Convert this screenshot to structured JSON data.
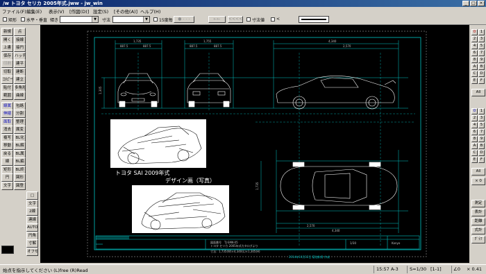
{
  "window": {
    "title": "/w トヨタ セリカ 2005年式.jww - jw_win",
    "min": "_",
    "max": "□",
    "close": "×"
  },
  "menu": [
    "ファイル(F)",
    "編集(E)",
    "表示(V)",
    "[作図(D)]",
    "設定(S)",
    "[その他(A)]",
    "ヘルプ(H)"
  ],
  "toolbar": {
    "rect": "矩形",
    "hv": "水平・垂直",
    "angle": "傾き",
    "dim": "寸法",
    "deg15": "15度毎",
    "dim_value": "寸法値",
    "arrow1": "<",
    "btn_left": "←←",
    "btn_mid": "<<<<"
  },
  "left_panel": {
    "buttons": [
      [
        "新規",
        "点"
      ],
      [
        "開く",
        "接線"
      ],
      [
        "上書",
        "接円"
      ],
      [
        "保存",
        "ハッチ"
      ],
      [
        "印刷",
        "建平"
      ],
      [
        "切取",
        "建断"
      ],
      [
        "コピー",
        "建立"
      ],
      [
        "貼付",
        "多角形"
      ],
      [
        "範囲",
        "曲線"
      ],
      [
        "線属",
        "包絡"
      ],
      [
        "伸縮",
        "分割"
      ],
      [
        "面取",
        "整理"
      ],
      [
        "消去",
        "属変"
      ],
      [
        "複写",
        "BL化"
      ],
      [
        "移動",
        "BL解"
      ],
      [
        "戻る",
        "BL属"
      ],
      [
        "線",
        "BL編"
      ],
      [
        "矩形",
        "BL終"
      ],
      [
        "円",
        "図形"
      ],
      [
        "文字",
        "図登"
      ]
    ],
    "mid_buttons": [
      [
        "/",
        "□"
      ],
      [
        "○",
        "文字"
      ],
      [
        "寸法",
        "2線"
      ],
      [
        "中心線",
        "連線"
      ],
      [
        "AUTO",
        ""
      ],
      [
        "線角",
        "円角"
      ],
      [
        "寸化",
        "寸解"
      ],
      [
        "ソリッド",
        "オフセット"
      ],
      [
        "寸取",
        "2.5D"
      ],
      [
        "日影",
        "天空"
      ],
      [
        "SPEED",
        "測定"
      ]
    ],
    "auto": "AUTO"
  },
  "right_panel": {
    "layer_digits": [
      "0",
      "1",
      "2",
      "3",
      "4",
      "5",
      "6",
      "7",
      "8",
      "9",
      "A",
      "B",
      "C",
      "D",
      "E",
      "F"
    ],
    "all": "All",
    "ex": "× 0",
    "bottom": [
      "測定",
      "表計",
      "距離",
      "式計",
      "ｸﾞﾗﾌ"
    ]
  },
  "drawing": {
    "caption1": "トヨタ SAI 2009年式",
    "caption2": "デザイン画（写真）",
    "dims_top": [
      "1,735",
      "1,755",
      "4,340",
      "2,570"
    ],
    "dims_top_left": [
      "887.5",
      "887.5"
    ],
    "dims_top_mid": [
      "887.5",
      "887.5"
    ],
    "dims_plan": [
      "2,570",
      "4,340"
    ],
    "height_left": "1,305",
    "height_plan": "1,735",
    "title_block": {
      "drawing_no_label": "図面番号",
      "drawing_no": "TJ-SMK-05",
      "model": "トヨタ セリカ 2005年式カタログより",
      "dims": "寸法：1,735(W)×4,340(L)×1,305(H)",
      "date": "2014年10月12日 菊池和男 作成",
      "scale": "1/30",
      "firm": "Kanyo"
    }
  },
  "status": {
    "hint": "始点を指示してください (L)free (R)Read",
    "paper": "A-3",
    "scale": "S=1/30",
    "layer": "[1-1]",
    "angle": "∠0",
    "zoom": "× 0.41",
    "time": "15:57"
  }
}
